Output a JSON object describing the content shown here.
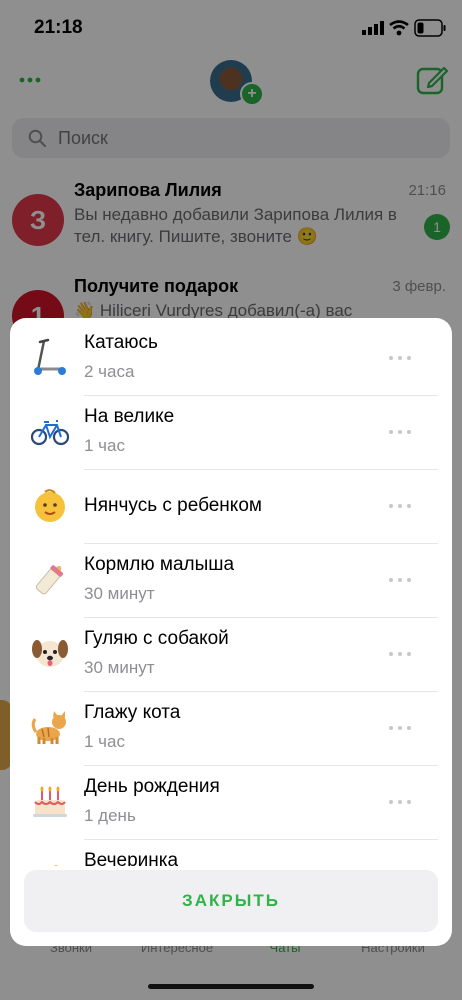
{
  "status_bar": {
    "time": "21:18"
  },
  "search": {
    "placeholder": "Поиск"
  },
  "chats": [
    {
      "avatar_text": "З",
      "name": "Зарипова Лилия",
      "time": "21:16",
      "preview": "Вы недавно добавили Зарипова Лилия в тел. книгу. Пишите, звоните 🙂",
      "badge": "1"
    },
    {
      "avatar_text": "1",
      "name": "Получите подарок",
      "time": "3 февр.",
      "preview": "👋 Hiliceri Vurdyres добавил(-а) вас"
    }
  ],
  "tabs": [
    {
      "label": "Звонки"
    },
    {
      "label": "Интересное"
    },
    {
      "label": "Чаты"
    },
    {
      "label": "Настройки"
    }
  ],
  "statuses": [
    {
      "emoji": "scooter-icon",
      "title": "Катаюсь",
      "duration": "2 часа"
    },
    {
      "emoji": "bicycle-icon",
      "title": "На велике",
      "duration": "1 час"
    },
    {
      "emoji": "baby-icon",
      "title": "Нянчусь с ребенком",
      "duration": ""
    },
    {
      "emoji": "baby-bottle-icon",
      "title": "Кормлю малыша",
      "duration": "30 минут"
    },
    {
      "emoji": "dog-icon",
      "title": "Гуляю с собакой",
      "duration": "30 минут"
    },
    {
      "emoji": "cat-icon",
      "title": "Глажу кота",
      "duration": "1 час"
    },
    {
      "emoji": "birthday-cake-icon",
      "title": "День рождения",
      "duration": "1 день"
    },
    {
      "emoji": "party-icon",
      "title": "Вечеринка",
      "duration": ""
    }
  ],
  "sheet": {
    "close_label": "ЗАКРЫТЬ"
  },
  "colors": {
    "accent": "#2fb34a",
    "badge_red": "#e0384a",
    "secondary_text": "#8e8e93"
  }
}
